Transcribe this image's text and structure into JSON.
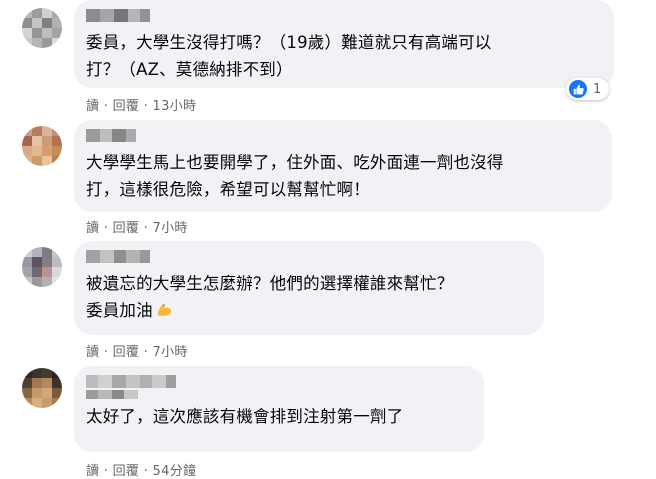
{
  "comments": [
    {
      "text": "委員，大學生沒得打嗎？（19歲）難道就只有高端可以\n打？（AZ、莫德納排不到）",
      "reply": "讀",
      "reply_btn": "回覆",
      "time": "13小時",
      "reaction_count": "1"
    },
    {
      "text": "大學學生馬上也要開學了，住外面、吃外面連一劑也沒得\n打，這樣很危險，希望可以幫幫忙啊！",
      "reply": "讀",
      "reply_btn": "回覆",
      "time": "7小時"
    },
    {
      "text": "被遺忘的大學生怎麼辦？他們的選擇權誰來幫忙？\n委員加油",
      "emoji": "flexed-biceps",
      "reply": "讀",
      "reply_btn": "回覆",
      "time": "7小時"
    },
    {
      "text": "太好了，這次應該有機會排到注射第一劑了",
      "reply": "讀",
      "reply_btn": "回覆",
      "time": "54分鐘"
    }
  ],
  "colors": {
    "bubble": "#f0f2f5",
    "meta": "#65676b",
    "like": "#1877f2"
  }
}
